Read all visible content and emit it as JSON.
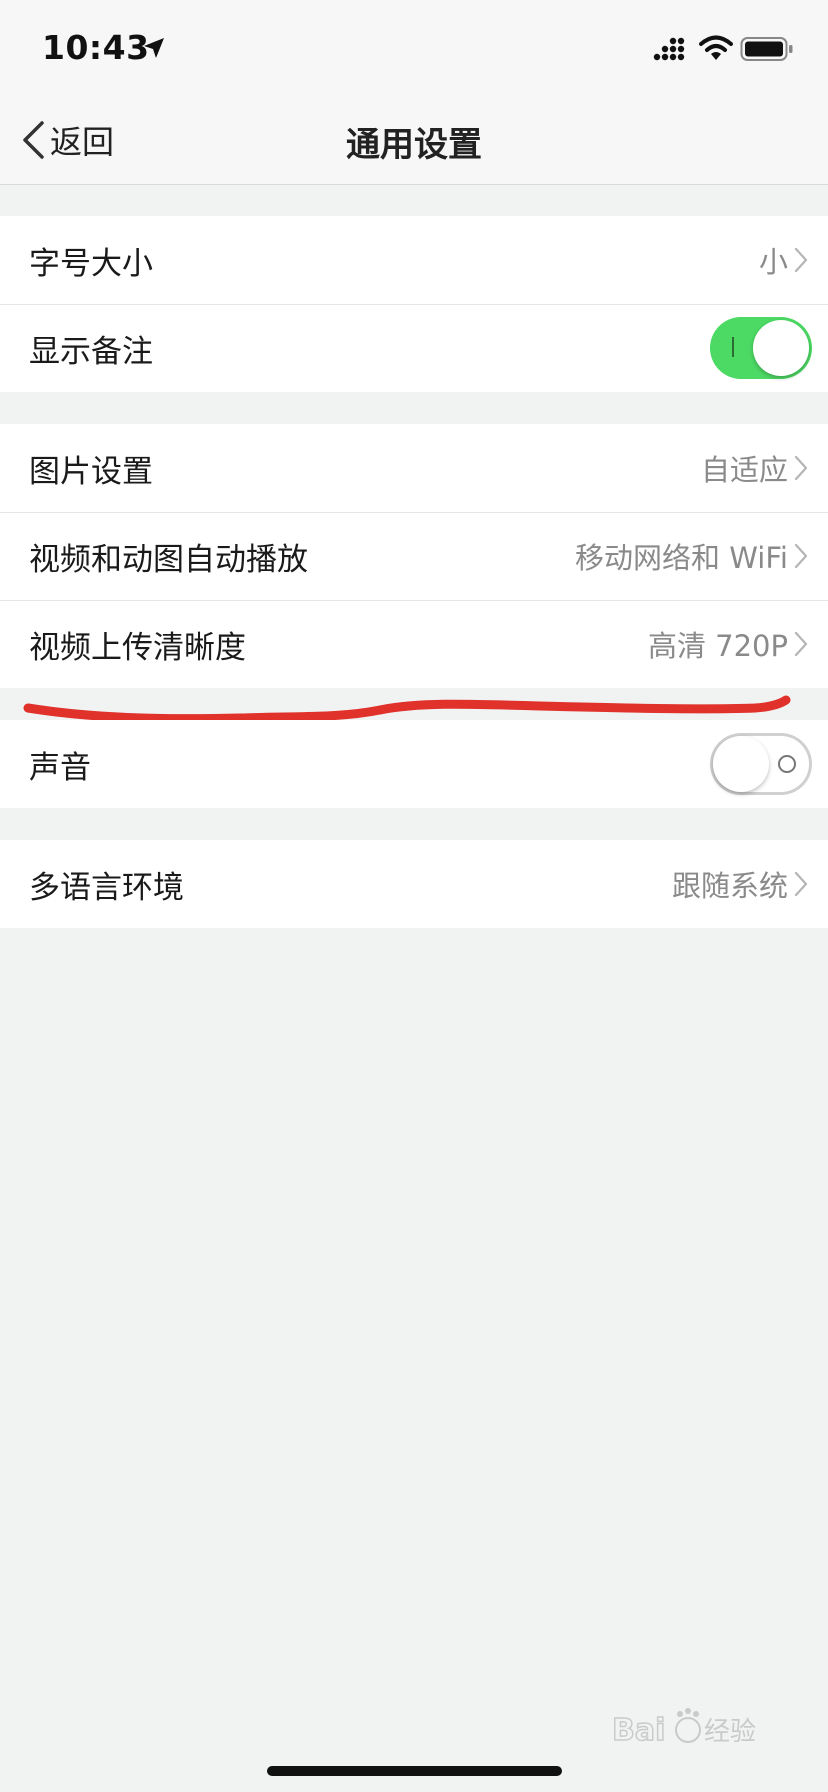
{
  "status_bar": {
    "time": "10:43"
  },
  "nav": {
    "back_label": "返回",
    "title": "通用设置"
  },
  "groups": [
    {
      "rows": [
        {
          "label": "字号大小",
          "value": "小"
        },
        {
          "label": "显示备注",
          "toggle": true
        }
      ]
    },
    {
      "rows": [
        {
          "label": "图片设置",
          "value": "自适应"
        },
        {
          "label": "视频和动图自动播放",
          "value": "移动网络和 WiFi"
        },
        {
          "label": "视频上传清晰度",
          "value": "高清 720P"
        }
      ]
    },
    {
      "rows": [
        {
          "label": "声音",
          "toggle": false
        }
      ]
    },
    {
      "rows": [
        {
          "label": "多语言环境",
          "value": "跟随系统"
        }
      ]
    }
  ],
  "watermark_text": "Baidu经验",
  "colors": {
    "toggle_on": "#4cd964",
    "annotation": "#e0312b"
  }
}
